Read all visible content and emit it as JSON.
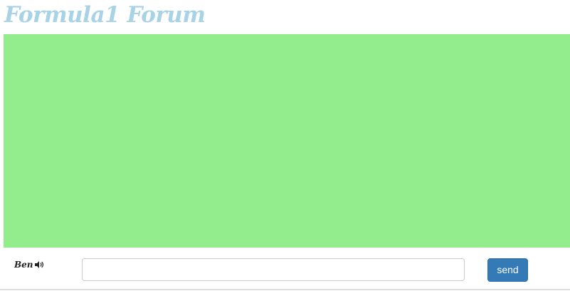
{
  "header": {
    "title": "Formula1 Forum"
  },
  "chat": {
    "messages": []
  },
  "composer": {
    "user_name": "Ben",
    "speaker_icon": "speaker-icon",
    "input_value": "",
    "input_placeholder": "",
    "send_label": "send"
  },
  "colors": {
    "title": "#a8d3e6",
    "chat_background": "#93ed8d",
    "send_button": "#337ab7"
  }
}
